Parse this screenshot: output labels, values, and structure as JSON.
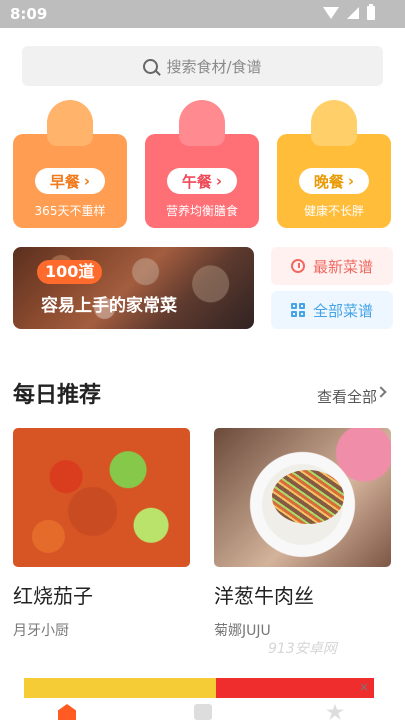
{
  "status_bar": {
    "time": "8:09"
  },
  "search": {
    "placeholder": "搜索食材/食谱"
  },
  "meal_cards": [
    {
      "label": "早餐",
      "subtitle": "365天不重样",
      "accent": "#ff9e52"
    },
    {
      "label": "午餐",
      "subtitle": "营养均衡膳食",
      "accent": "#ff6f76"
    },
    {
      "label": "晚餐",
      "subtitle": "健康不长胖",
      "accent": "#ffbd3a"
    }
  ],
  "promo": {
    "count": "100道",
    "title": "容易上手的家常菜"
  },
  "recipe_buttons": [
    {
      "label": "最新菜谱",
      "icon": "clock-icon"
    },
    {
      "label": "全部菜谱",
      "icon": "grid-icon"
    }
  ],
  "daily": {
    "title": "每日推荐",
    "see_all": "查看全部"
  },
  "recipes": [
    {
      "name": "红烧茄子",
      "author": "月牙小厨"
    },
    {
      "name": "洋葱牛肉丝",
      "author": "菊娜JUJU"
    }
  ],
  "watermark": "913安卓网",
  "ad": {
    "close": "×"
  }
}
